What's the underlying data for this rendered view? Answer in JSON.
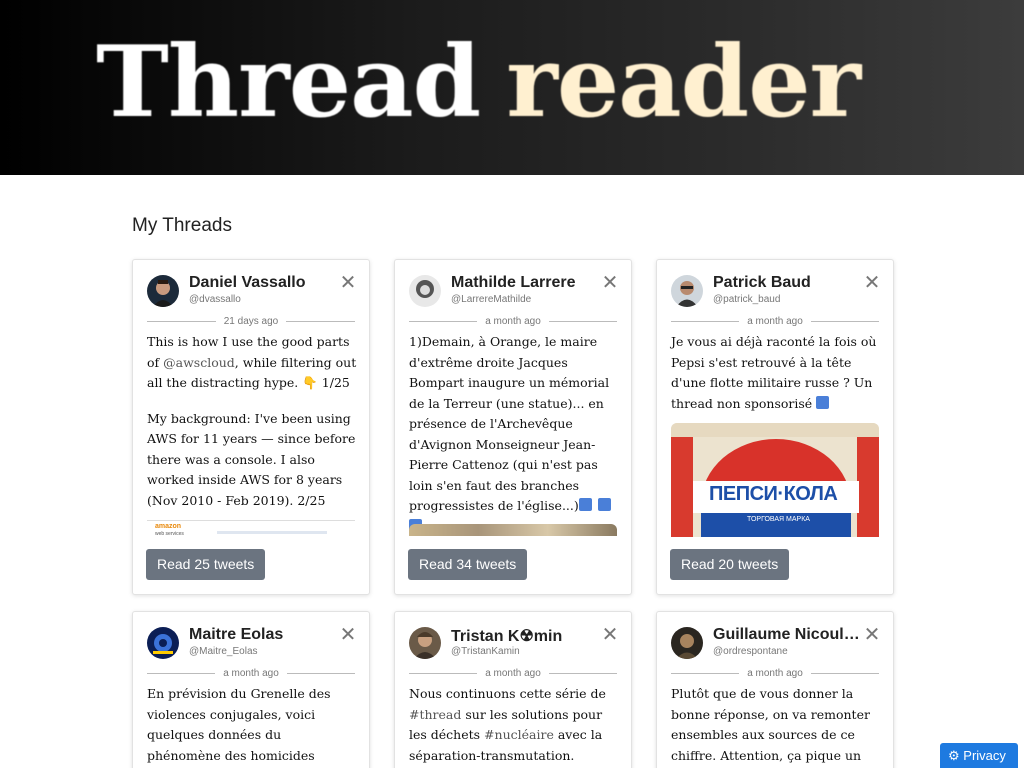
{
  "banner": {
    "word1": "Thread",
    "word2": "reader"
  },
  "section_title": "My Threads",
  "cards": [
    {
      "name": "Daniel Vassallo",
      "handle": "@dvassallo",
      "time": "21 days ago",
      "para1_pre": "This is how I use the good parts of ",
      "para1_tag": "@awscloud",
      "para1_post": ", while filtering out all the distracting hype. ",
      "para1_emoji": "👇",
      "para1_end": " 1/25",
      "para2": "My background: I've been using AWS for 11 years — since before there was a console. I also worked inside AWS for 8 years (Nov 2010 - Feb 2019). 2/25",
      "read_label": "Read 25 tweets",
      "close": "✕"
    },
    {
      "name": "Mathilde Larrere",
      "handle": "@LarrereMathilde",
      "time": "a month ago",
      "para1": "1)Demain, à Orange, le maire d'extrême droite Jacques Bompart inaugure un mémorial de la Terreur (une statue)... en présence de l'Archevêque d'Avignon Monseigneur Jean-Pierre Cattenoz (qui n'est pas loin s'en faut des branches progressistes de l'église...)",
      "read_label": "Read 34 tweets",
      "close": "✕"
    },
    {
      "name": "Patrick Baud",
      "handle": "@patrick_baud",
      "time": "a month ago",
      "para1": "Je vous ai déjà raconté la fois où Pepsi s'est retrouvé à la tête d'une flotte militaire russe ? Un thread non sponsorisé",
      "image_text": "ПЕПСИ·КОЛА",
      "image_sub": "ТОРГОВАЯ МАРКА",
      "read_label": "Read 20 tweets",
      "close": "✕"
    },
    {
      "name": "Maitre Eolas",
      "handle": "@Maitre_Eolas",
      "time": "a month ago",
      "para1": "En prévision du Grenelle des violences conjugales, voici quelques données du phénomène des homicides conjugaux (j'entends par",
      "close": "✕"
    },
    {
      "name": "Tristan K☢min",
      "handle": "@TristanKamin",
      "time": "a month ago",
      "para1_pre": "Nous continuons cette série de ",
      "para1_tag": "#thread",
      "para1_mid": " sur les solutions pour les déchets ",
      "para1_tag2": "#nucléaire",
      "para1_post": " avec la séparation-transmutation.",
      "close": "✕"
    },
    {
      "name": "Guillaume Nicoulaud",
      "handle": "@ordrespontane",
      "time": "a month ago",
      "para1": "Plutôt que de vous donner la bonne réponse, on va remonter ensembles aux sources de ce chiffre. Attention, ça pique un peu des yeux : vous êtes",
      "close": "✕"
    }
  ],
  "aws_logo": "amazon",
  "aws_logo_sub": "web services",
  "privacy_label": "Privacy",
  "colors": {
    "button": "#6b7480",
    "privacy": "#1e7ae0"
  }
}
